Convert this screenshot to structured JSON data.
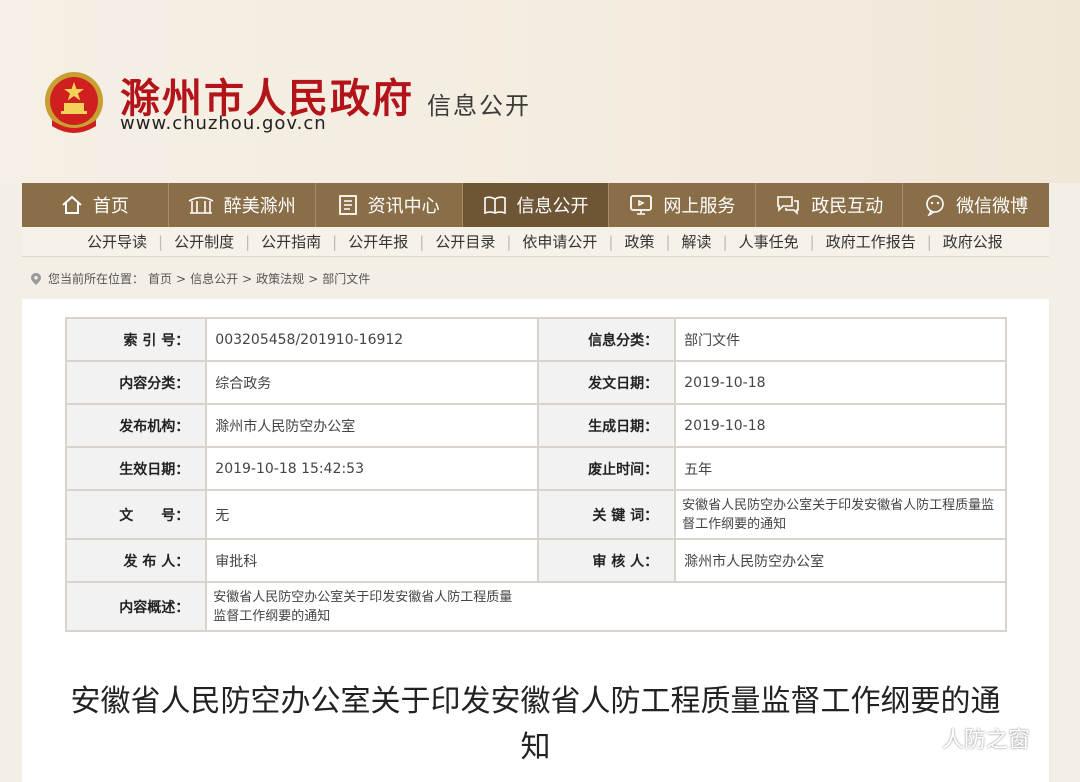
{
  "header": {
    "title": "滁州市人民政府",
    "subtitle": "信息公开",
    "url": "www.chuzhou.gov.cn"
  },
  "nav": [
    {
      "label": "首页",
      "icon": "home-icon"
    },
    {
      "label": "醉美滁州",
      "icon": "pavilion-icon"
    },
    {
      "label": "资讯中心",
      "icon": "document-icon"
    },
    {
      "label": "信息公开",
      "icon": "book-icon"
    },
    {
      "label": "网上服务",
      "icon": "monitor-icon"
    },
    {
      "label": "政民互动",
      "icon": "chat-icon"
    },
    {
      "label": "微信微博",
      "icon": "wechat-icon"
    }
  ],
  "subnav": [
    "公开导读",
    "公开制度",
    "公开指南",
    "公开年报",
    "公开目录",
    "依申请公开",
    "政策",
    "解读",
    "人事任免",
    "政府工作报告",
    "政府公报"
  ],
  "breadcrumb": {
    "prefix": "您当前所在位置：",
    "items": [
      "首页",
      "信息公开",
      "政策法规",
      "部门文件"
    ],
    "sep": ">"
  },
  "meta": {
    "index_label": "索 引 号：",
    "index_value": "003205458/201910-16912",
    "category_label": "信息分类：",
    "category_value": "部门文件",
    "content_class_label": "内容分类：",
    "content_class_value": "综合政务",
    "issue_date_label": "发文日期：",
    "issue_date_value": "2019-10-18",
    "publisher_org_label": "发布机构：",
    "publisher_org_value": "滁州市人民防空办公室",
    "gen_date_label": "生成日期：",
    "gen_date_value": "2019-10-18",
    "effective_label": "生效日期：",
    "effective_value": "2019-10-18 15:42:53",
    "expiry_label": "废止时间：",
    "expiry_value": "五年",
    "doc_no_label": "文　　号：",
    "doc_no_value": "无",
    "keywords_label": "关 键 词：",
    "keywords_value": "安徽省人民防空办公室关于印发安徽省人防工程质量监督工作纲要的通知",
    "publisher_label": "发 布 人：",
    "publisher_value": "审批科",
    "reviewer_label": "审 核 人：",
    "reviewer_value": "滁州市人民防空办公室",
    "summary_label": "内容概述：",
    "summary_value": "安徽省人民防空办公室关于印发安徽省人防工程质量监督工作纲要的通知"
  },
  "doc_title": "安徽省人民防空办公室关于印发安徽省人防工程质量监督工作纲要的通知",
  "watermark": "人防之窗",
  "colors": {
    "brand_red": "#b3141a",
    "nav_brown": "#8a6e48",
    "nav_active": "#6e5536"
  }
}
